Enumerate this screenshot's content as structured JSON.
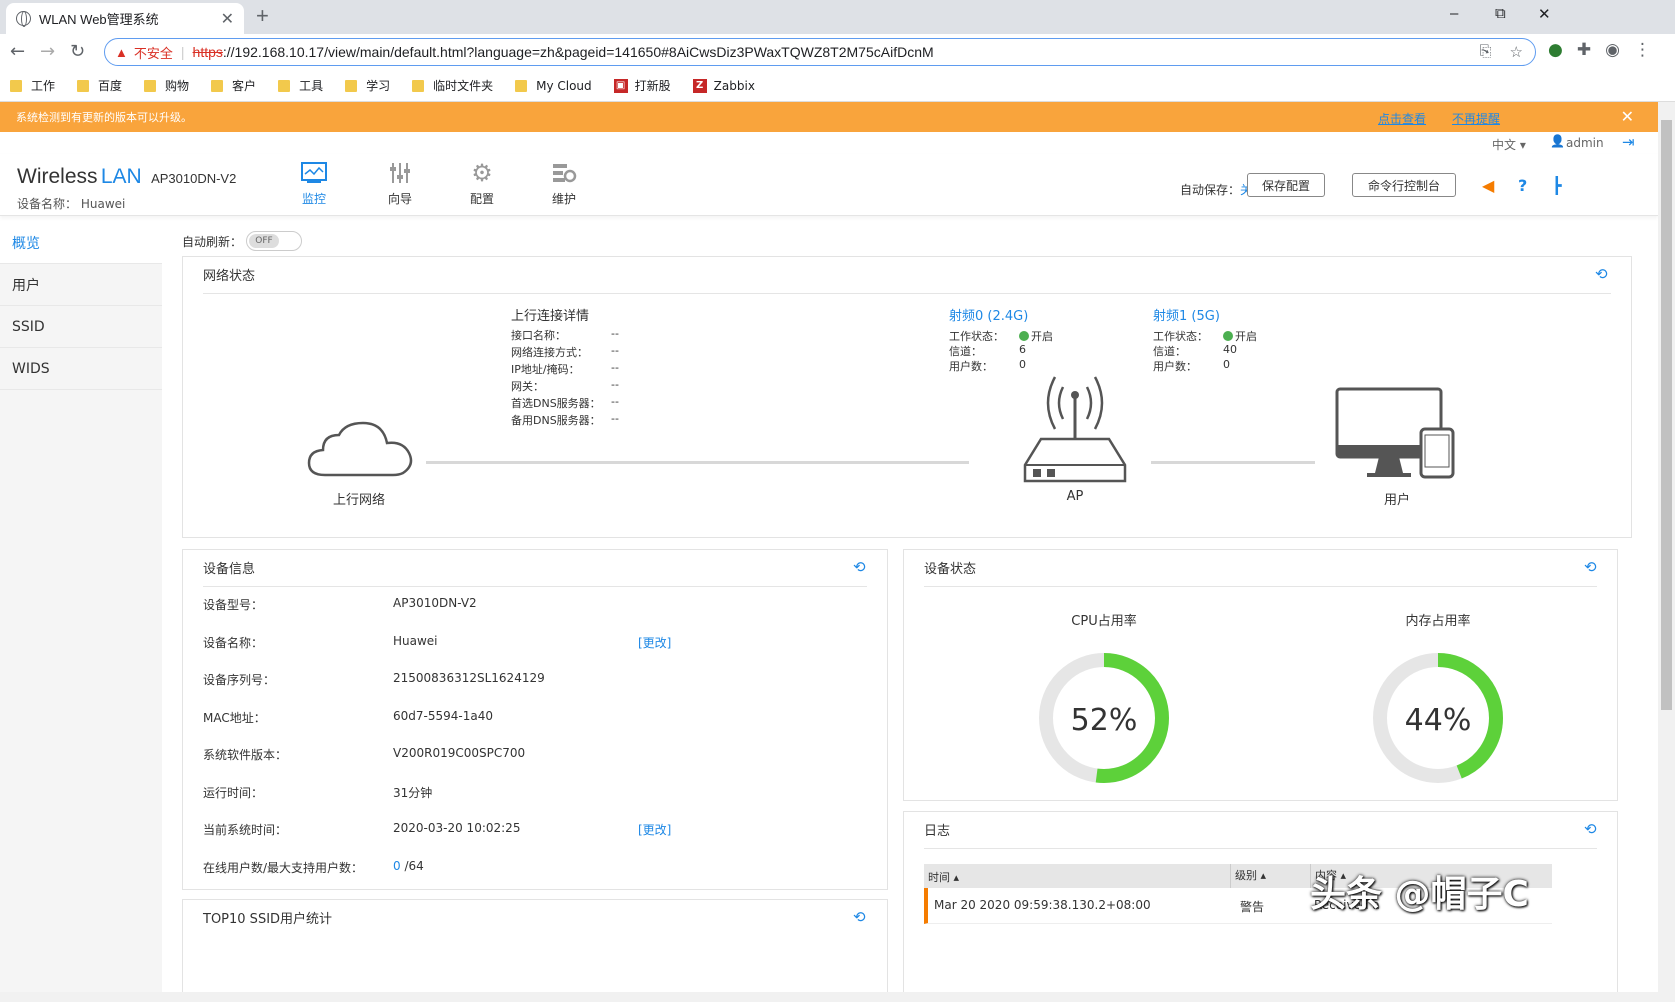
{
  "browser": {
    "tab_title": "WLAN Web管理系统",
    "new_tab": "+",
    "window": {
      "minimize": "–",
      "restore": "⧉",
      "close": "✕"
    },
    "insecure_label": "不安全",
    "url_protocol": "https",
    "url_rest": "://192.168.10.17/view/main/default.html?language=zh&pageid=141650#8AiCwsDiz3PWaxTQWZ8T2M75cAifDcnM",
    "bookmarks": [
      {
        "label": "工作",
        "icon": "folder-icon"
      },
      {
        "label": "百度",
        "icon": "folder-icon"
      },
      {
        "label": "购物",
        "icon": "folder-icon"
      },
      {
        "label": "客户",
        "icon": "folder-icon"
      },
      {
        "label": "工具",
        "icon": "folder-icon"
      },
      {
        "label": "学习",
        "icon": "folder-icon"
      },
      {
        "label": "临时文件夹",
        "icon": "folder-icon"
      },
      {
        "label": "My Cloud",
        "icon": "folder-icon"
      },
      {
        "label": "打新股",
        "icon": "stock-icon"
      },
      {
        "label": "Zabbix",
        "icon": "zabbix-icon"
      }
    ]
  },
  "notice": {
    "text": "系统检测到有更新的版本可以升级。",
    "view_link": "点击查看",
    "dismiss_link": "不再提醒"
  },
  "topbar": {
    "language": "中文",
    "user": "admin"
  },
  "header": {
    "brand_wireless": "Wireless",
    "brand_lan": "LAN",
    "model": "AP3010DN-V2",
    "device_name_label": "设备名称：",
    "device_name": "Huawei",
    "nav": [
      {
        "label": "监控",
        "icon": "monitor-icon",
        "active": true
      },
      {
        "label": "向导",
        "icon": "wizard-icon",
        "active": false
      },
      {
        "label": "配置",
        "icon": "gear-icon",
        "active": false
      },
      {
        "label": "维护",
        "icon": "maintenance-icon",
        "active": false
      }
    ],
    "autosave_label": "自动保存：",
    "autosave_value": "关闭",
    "save_config": "保存配置",
    "cli_console": "命令行控制台"
  },
  "sidebar": {
    "items": [
      {
        "label": "概览",
        "active": true
      },
      {
        "label": "用户",
        "active": false
      },
      {
        "label": "SSID",
        "active": false
      },
      {
        "label": "WIDS",
        "active": false
      }
    ]
  },
  "auto_refresh": {
    "label": "自动刷新：",
    "state": "OFF"
  },
  "network_status": {
    "title": "网络状态",
    "uplink_title": "上行连接详情",
    "uplink_fields": [
      {
        "label": "接口名称：",
        "value": "--"
      },
      {
        "label": "网络连接方式：",
        "value": "--"
      },
      {
        "label": "IP地址/掩码：",
        "value": "--"
      },
      {
        "label": "网关：",
        "value": "--"
      },
      {
        "label": "首选DNS服务器：",
        "value": "--"
      },
      {
        "label": "备用DNS服务器：",
        "value": "--"
      }
    ],
    "radios": [
      {
        "title": "射频0 (2.4G)",
        "status_label": "工作状态：",
        "status": "开启",
        "channel_label": "信道：",
        "channel": "6",
        "users_label": "用户数：",
        "users": "0"
      },
      {
        "title": "射频1 (5G)",
        "status_label": "工作状态：",
        "status": "开启",
        "channel_label": "信道：",
        "channel": "40",
        "users_label": "用户数：",
        "users": "0"
      }
    ],
    "nodes": {
      "uplink": "上行网络",
      "ap": "AP",
      "users": "用户"
    }
  },
  "device_info": {
    "title": "设备信息",
    "change_label": "[更改]",
    "rows": [
      {
        "label": "设备型号：",
        "value": "AP3010DN-V2"
      },
      {
        "label": "设备名称：",
        "value": "Huawei"
      },
      {
        "label": "设备序列号：",
        "value": "21500836312SL1624129"
      },
      {
        "label": "MAC地址：",
        "value": "60d7-5594-1a40"
      },
      {
        "label": "系统软件版本：",
        "value": "V200R019C00SPC700"
      },
      {
        "label": "运行时间：",
        "value": "31分钟"
      },
      {
        "label": "当前系统时间：",
        "value": "2020-03-20 10:02:25"
      },
      {
        "label": "在线用户数/最大支持用户数：",
        "value_online": "0",
        "value_max": "/64"
      }
    ]
  },
  "top10": {
    "title": "TOP10 SSID用户统计"
  },
  "device_status": {
    "title": "设备状态",
    "cpu": {
      "label": "CPU占用率",
      "percent": 52,
      "text": "52%"
    },
    "memory": {
      "label": "内存占用率",
      "percent": 44,
      "text": "44%"
    },
    "colors": {
      "used": "#5dd13a",
      "free": "#e6e6e6"
    }
  },
  "log": {
    "title": "日志",
    "headers": [
      "时间 ▴",
      "级别 ▴",
      "内容 ▴"
    ],
    "rows": [
      {
        "time": "Mar 20 2020 09:59:38.130.2+08:00",
        "level": "警告",
        "content": "Received a"
      }
    ]
  },
  "watermark": "头条 @帽子C"
}
